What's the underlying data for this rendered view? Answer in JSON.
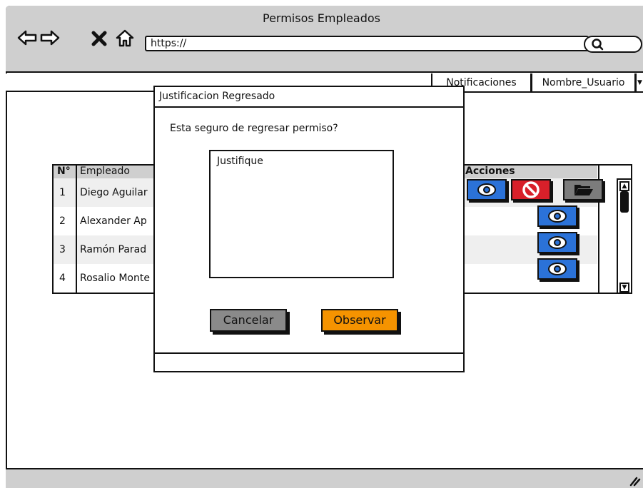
{
  "window": {
    "title": "Permisos Empleados",
    "url": "https://"
  },
  "icons": {
    "back": "arrow-left-icon",
    "forward": "arrow-right-icon",
    "stop": "close-icon",
    "home": "home-icon",
    "search": "search-icon",
    "view": "eye-icon",
    "reject": "block-icon",
    "folder": "folder-open-icon",
    "resize": "resize-grip-icon"
  },
  "topbar": {
    "notifications": "Notificaciones",
    "user": "Nombre_Usuario"
  },
  "table": {
    "headers": {
      "num": "N°",
      "employee": "Empleado",
      "actions": "Acciones"
    },
    "rows": [
      {
        "num": "1",
        "employee": "Diego Aguilar"
      },
      {
        "num": "2",
        "employee": "Alexander Ap"
      },
      {
        "num": "3",
        "employee": "Ramón Parad"
      },
      {
        "num": "4",
        "employee": "Rosalio Monte"
      }
    ]
  },
  "modal": {
    "title": "Justificacion Regresado",
    "question": "Esta seguro de regresar permiso?",
    "textarea_placeholder": "Justifique",
    "cancel": "Cancelar",
    "confirm": "Observar"
  },
  "colors": {
    "chrome": "#cfcfcf",
    "view_button": "#2b72d8",
    "reject_button": "#d8202a",
    "folder_button": "#7c7c7c",
    "confirm_button": "#f59300",
    "cancel_button": "#8a8a8a"
  }
}
